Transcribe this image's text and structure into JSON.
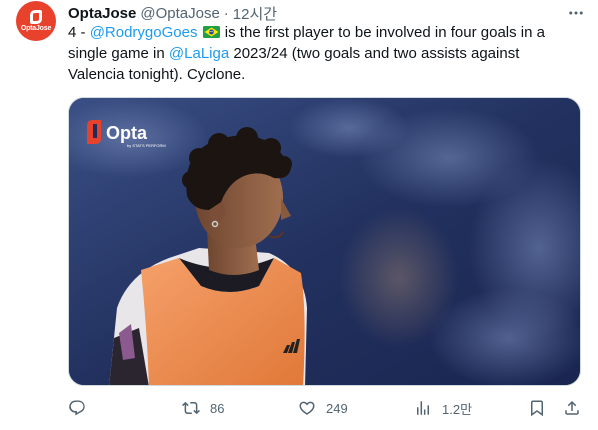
{
  "author": {
    "name": "OptaJose",
    "handle": "@OptaJose",
    "time": "12시간",
    "separator": "·",
    "avatar_text": "OptaJose"
  },
  "tweet": {
    "prefix": "4 - ",
    "mention_player": "@RodrygoGoes",
    "flag": "brazil-flag",
    "line_a": " is the first player to be involved in four goals in a single game in ",
    "mention_league": "@LaLiga",
    "line_b": " 2023/24 (two goals and two assists against Valencia tonight). Cyclone."
  },
  "media": {
    "watermark_title": "Opta",
    "watermark_sub": "by STATS PERFORM"
  },
  "actions": {
    "reply_icon": "reply-icon",
    "retweet_count": "86",
    "like_count": "249",
    "views_count": "1.2만"
  },
  "colors": {
    "accent": "#1d9bf0",
    "opta_brand": "#e8412c",
    "muted": "#536471",
    "bib": "#ef8a4a"
  }
}
